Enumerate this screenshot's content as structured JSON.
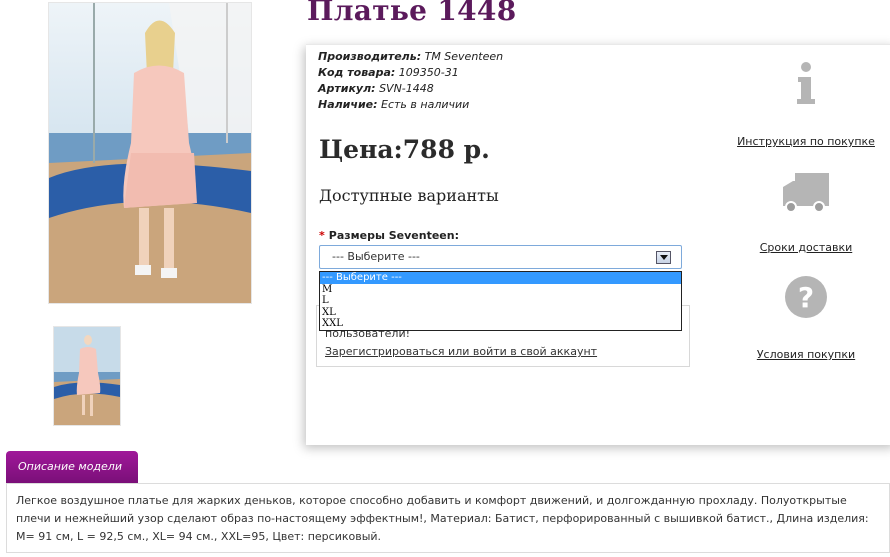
{
  "product": {
    "title": "Платье 1448",
    "meta": [
      {
        "label": "Производитель:",
        "value": "TM Seventeen"
      },
      {
        "label": "Код товара:",
        "value": "109350-31"
      },
      {
        "label": "Артикул:",
        "value": "SVN-1448"
      },
      {
        "label": "Наличие:",
        "value": "Есть в наличии"
      }
    ],
    "price": "Цена:788 р.",
    "variants_heading": "Доступные варианты",
    "size_label": "Размеры Seventeen:",
    "required_mark": "*",
    "select_value": "--- Выберите ---",
    "select_options": [
      "--- Выберите ---",
      "M",
      "L",
      "XL",
      "XXL"
    ],
    "notice_text": "пользователи!",
    "notice_link": "Зарегистрироваться или войти в свой аккаунт"
  },
  "sidebar": {
    "instructions": "Инструкция по покупке",
    "delivery": "Сроки доставки",
    "terms": "Условия покупки"
  },
  "description": {
    "tab": "Описание модели",
    "text": "Легкое воздушное платье для жарких деньков, которое способно добавить и комфорт движений, и долгожданную прохладу. Полуоткрытые плечи и нежнейший узор сделают образ по-настоящему эффектным!, Материал: Батист, перфорированный с вышивкой батист., Длина изделия: M= 91 см, L = 92,5 см., XL= 94 см., XXL=95, Цвет: персиковый."
  },
  "colors": {
    "title": "#5b1a5c",
    "tab": "#8e1488",
    "select_highlight": "#3399ff"
  },
  "icons": [
    "info-icon",
    "truck-icon",
    "question-icon",
    "dropdown-arrow-icon"
  ]
}
